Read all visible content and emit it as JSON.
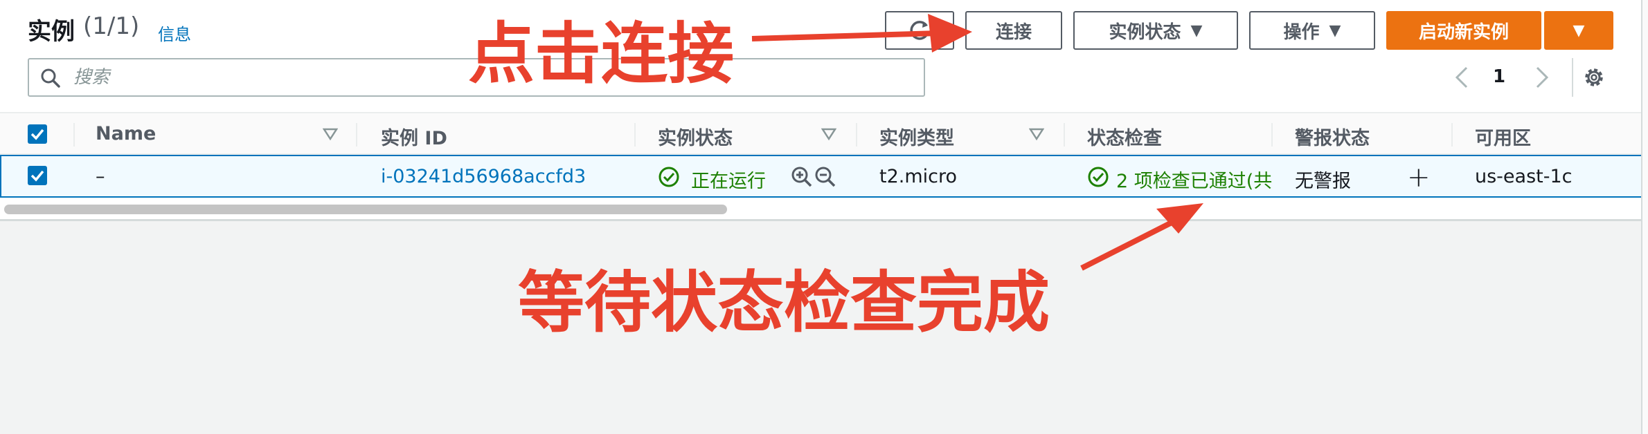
{
  "header": {
    "title": "实例",
    "count": "(1/1)",
    "info_link": "信息"
  },
  "toolbar": {
    "connect_label": "连接",
    "instance_state_label": "实例状态",
    "actions_label": "操作",
    "launch_label": "启动新实例"
  },
  "search": {
    "placeholder": "搜索"
  },
  "pagination": {
    "current_page": "1"
  },
  "table": {
    "columns": [
      "Name",
      "实例 ID",
      "实例状态",
      "实例类型",
      "状态检查",
      "警报状态",
      "可用区"
    ],
    "rows": [
      {
        "name": "–",
        "instance_id": "i-03241d56968accfd3",
        "instance_state": "正在运行",
        "instance_type": "t2.micro",
        "status_check": "2 项检查已通过(共",
        "alarm_status": "无警报",
        "availability_zone": "us-east-1c"
      }
    ]
  },
  "annotations": {
    "top": "点击连接",
    "bottom": "等待状态检查完成"
  },
  "colors": {
    "accent": "#0073bb",
    "primary_button": "#ec7211",
    "success": "#1d8102",
    "annotation": "#e8412d"
  }
}
